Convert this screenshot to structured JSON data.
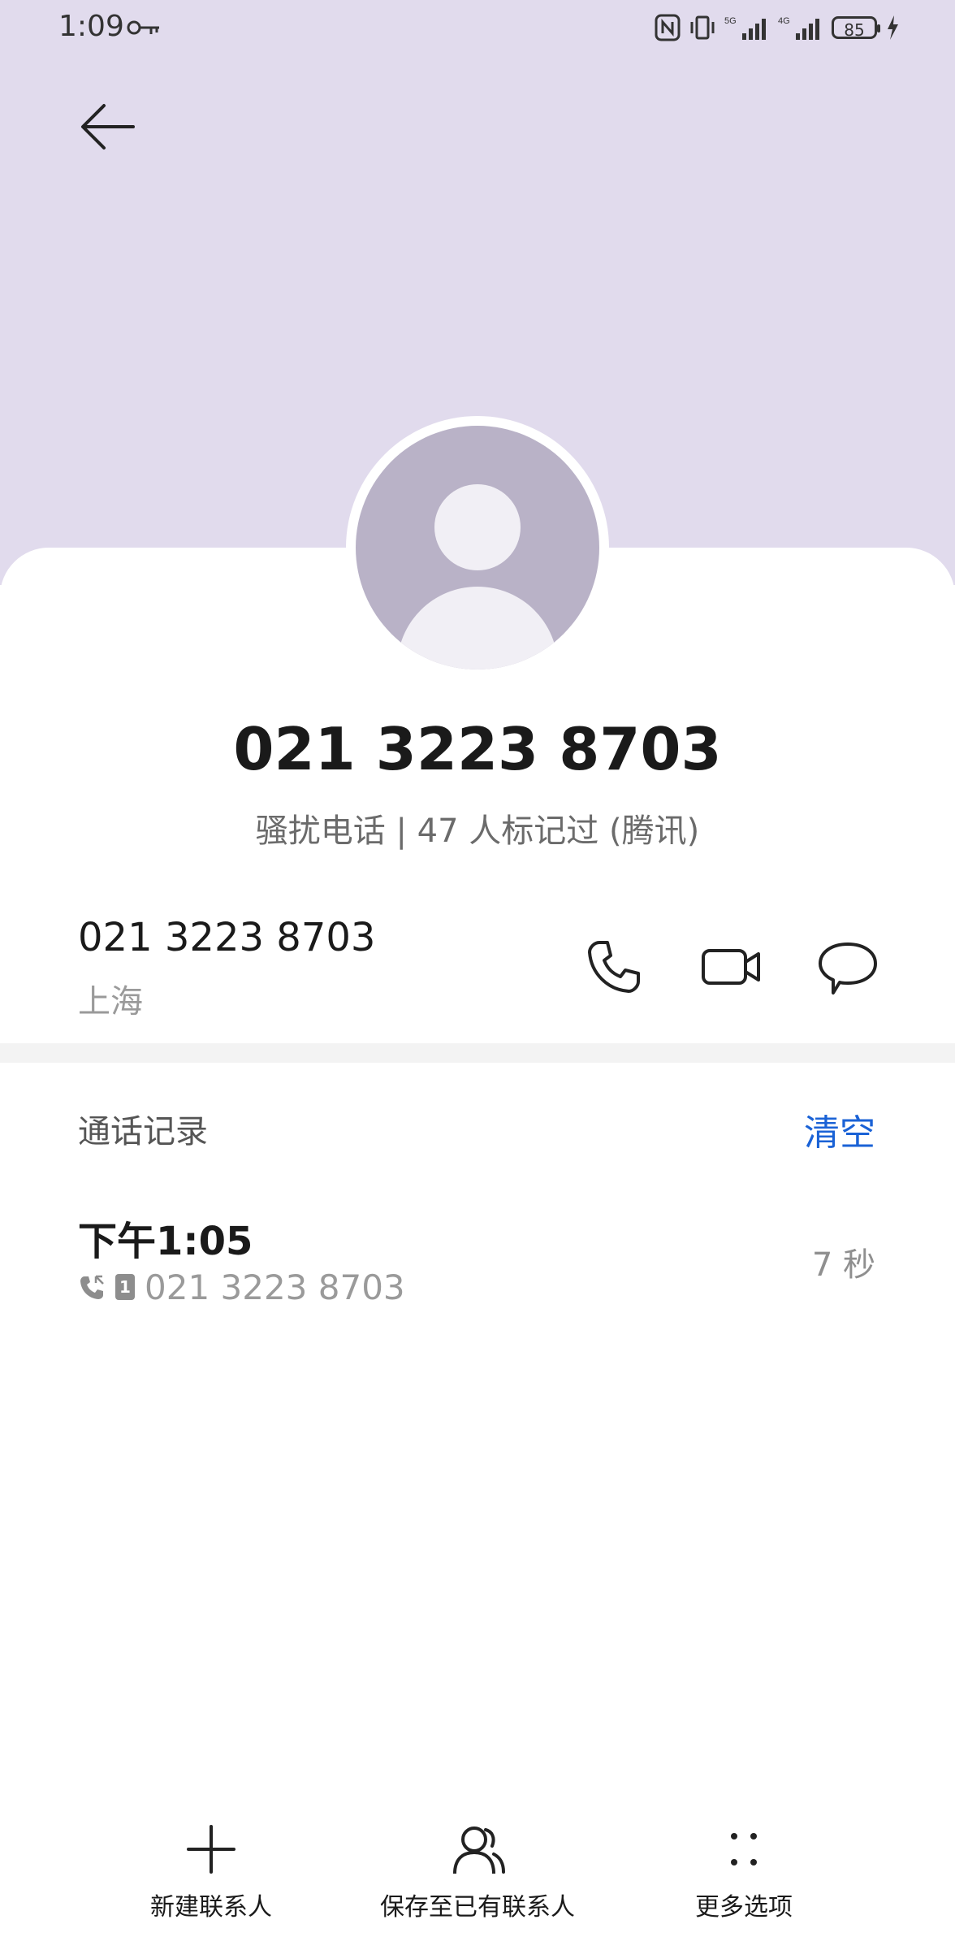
{
  "status_bar": {
    "time": "1:09",
    "battery": "85"
  },
  "contact": {
    "number_display": "021 3223 8703",
    "tag_line": "骚扰电话 | 47 人标记过 (腾讯)"
  },
  "number_row": {
    "number": "021 3223 8703",
    "location": "上海"
  },
  "call_log": {
    "title": "通话记录",
    "clear_label": "清空",
    "entries": [
      {
        "time": "下午1:05",
        "number": "021 3223 8703",
        "sim": "1",
        "duration": "7 秒"
      }
    ]
  },
  "bottom_bar": {
    "new_contact": "新建联系人",
    "save_existing": "保存至已有联系人",
    "more_options": "更多选项"
  },
  "colors": {
    "header_bg": "#e1dbed",
    "avatar_bg": "#b9b2c7",
    "accent_blue": "#1a62d6"
  }
}
